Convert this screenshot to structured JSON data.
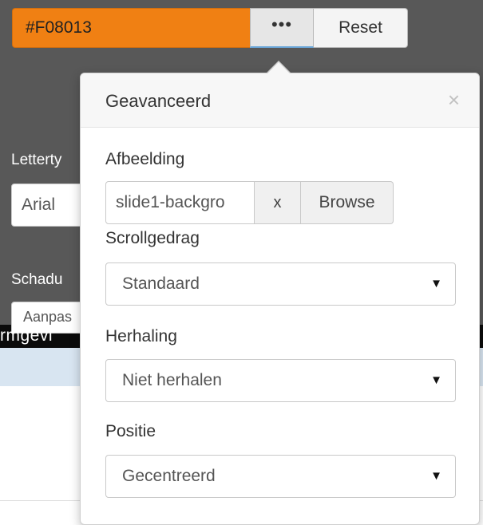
{
  "color_input": {
    "value": "#F08013",
    "color": "#F08013"
  },
  "buttons": {
    "ellipsis_label": "•••",
    "reset_label": "Reset"
  },
  "background_panel": {
    "font_label": "Letterty",
    "font_value": "Arial",
    "shadow_label": "Schadu",
    "shadow_value": "Aanpas",
    "section_label": "rmgevi"
  },
  "popover": {
    "title": "Geavanceerd",
    "close_symbol": "×",
    "image": {
      "label": "Afbeelding",
      "value": "slide1-backgro",
      "clear_label": "x",
      "browse_label": "Browse"
    },
    "scroll": {
      "label": "Scrollgedrag",
      "value": "Standaard"
    },
    "repeat": {
      "label": "Herhaling",
      "value": "Niet herhalen"
    },
    "position": {
      "label": "Positie",
      "value": "Gecentreerd"
    }
  },
  "icons": {
    "dropdown": "caret-down-icon",
    "close": "close-icon"
  }
}
